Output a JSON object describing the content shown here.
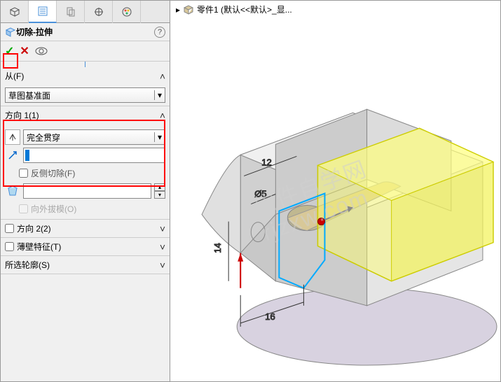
{
  "breadcrumb": {
    "part_label": "零件1 (默认<<默认>_显..."
  },
  "feature": {
    "title": "切除-拉伸"
  },
  "sections": {
    "from": {
      "label": "从(F)",
      "value": "草图基准面"
    },
    "direction1": {
      "label": "方向 1(1)",
      "end_condition": "完全贯穿",
      "flip_side": "反侧切除(F)",
      "draft_outward": "向外拔模(O)",
      "draft_value": ""
    },
    "direction2": {
      "label": "方向 2(2)"
    },
    "thin_feature": {
      "label": "薄壁特征(T)"
    },
    "contours": {
      "label": "所选轮廓(S)"
    }
  },
  "dimensions": {
    "d1": "12",
    "d2": "Ø5",
    "d3": "14",
    "d4": "16"
  },
  "watermark": "软件自学网 rjzxw.com"
}
